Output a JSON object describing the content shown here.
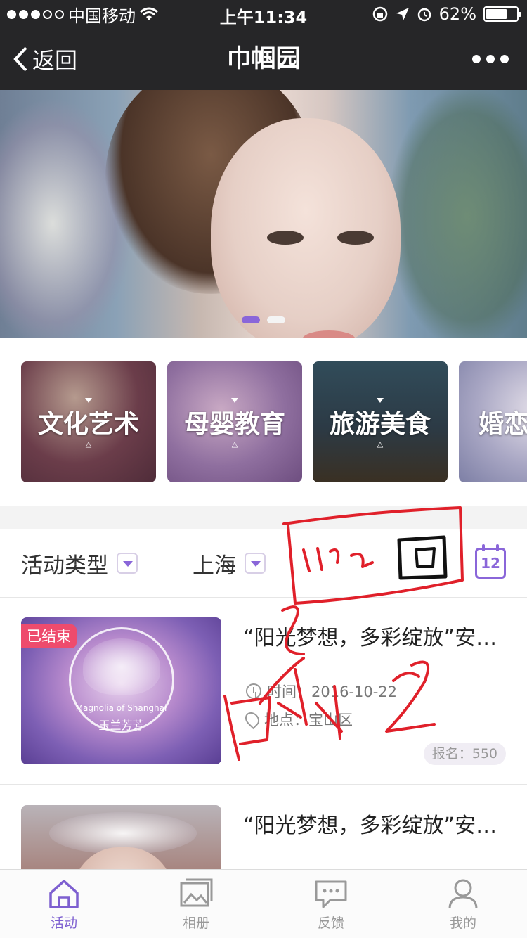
{
  "status_bar": {
    "carrier": "中国移动",
    "time": "上午11:34",
    "battery": "62%",
    "battery_level": 0.62
  },
  "nav": {
    "back_label": "返回",
    "title": "巾帼园"
  },
  "banner": {
    "slide_count": 2,
    "active_slide": 1
  },
  "categories": [
    {
      "label": "文化艺术"
    },
    {
      "label": "母婴教育"
    },
    {
      "label": "旅游美食"
    },
    {
      "label": "婚恋"
    }
  ],
  "filter": {
    "type_label": "活动类型",
    "city_label": "上海",
    "calendar_day": "12"
  },
  "activities": [
    {
      "status": "已结束",
      "title": "“阳光梦想，多彩绽放”安…",
      "time": "时间：2016-10-22",
      "place": "地点：宝山区",
      "signup": "报名：550",
      "thumb_caption": "Magnolia of Shanghai",
      "thumb_caption_2": "玉兰芳芳"
    },
    {
      "title": "“阳光梦想，多彩绽放”安…"
    }
  ],
  "tabs": [
    {
      "label": "活动",
      "active": true
    },
    {
      "label": "相册",
      "active": false
    },
    {
      "label": "反馈",
      "active": false
    },
    {
      "label": "我的",
      "active": false
    }
  ],
  "colors": {
    "bar_bg": "#262628",
    "accent": "#8a66d9",
    "badge": "#ee4b6d",
    "annotation": "#e0202a"
  }
}
